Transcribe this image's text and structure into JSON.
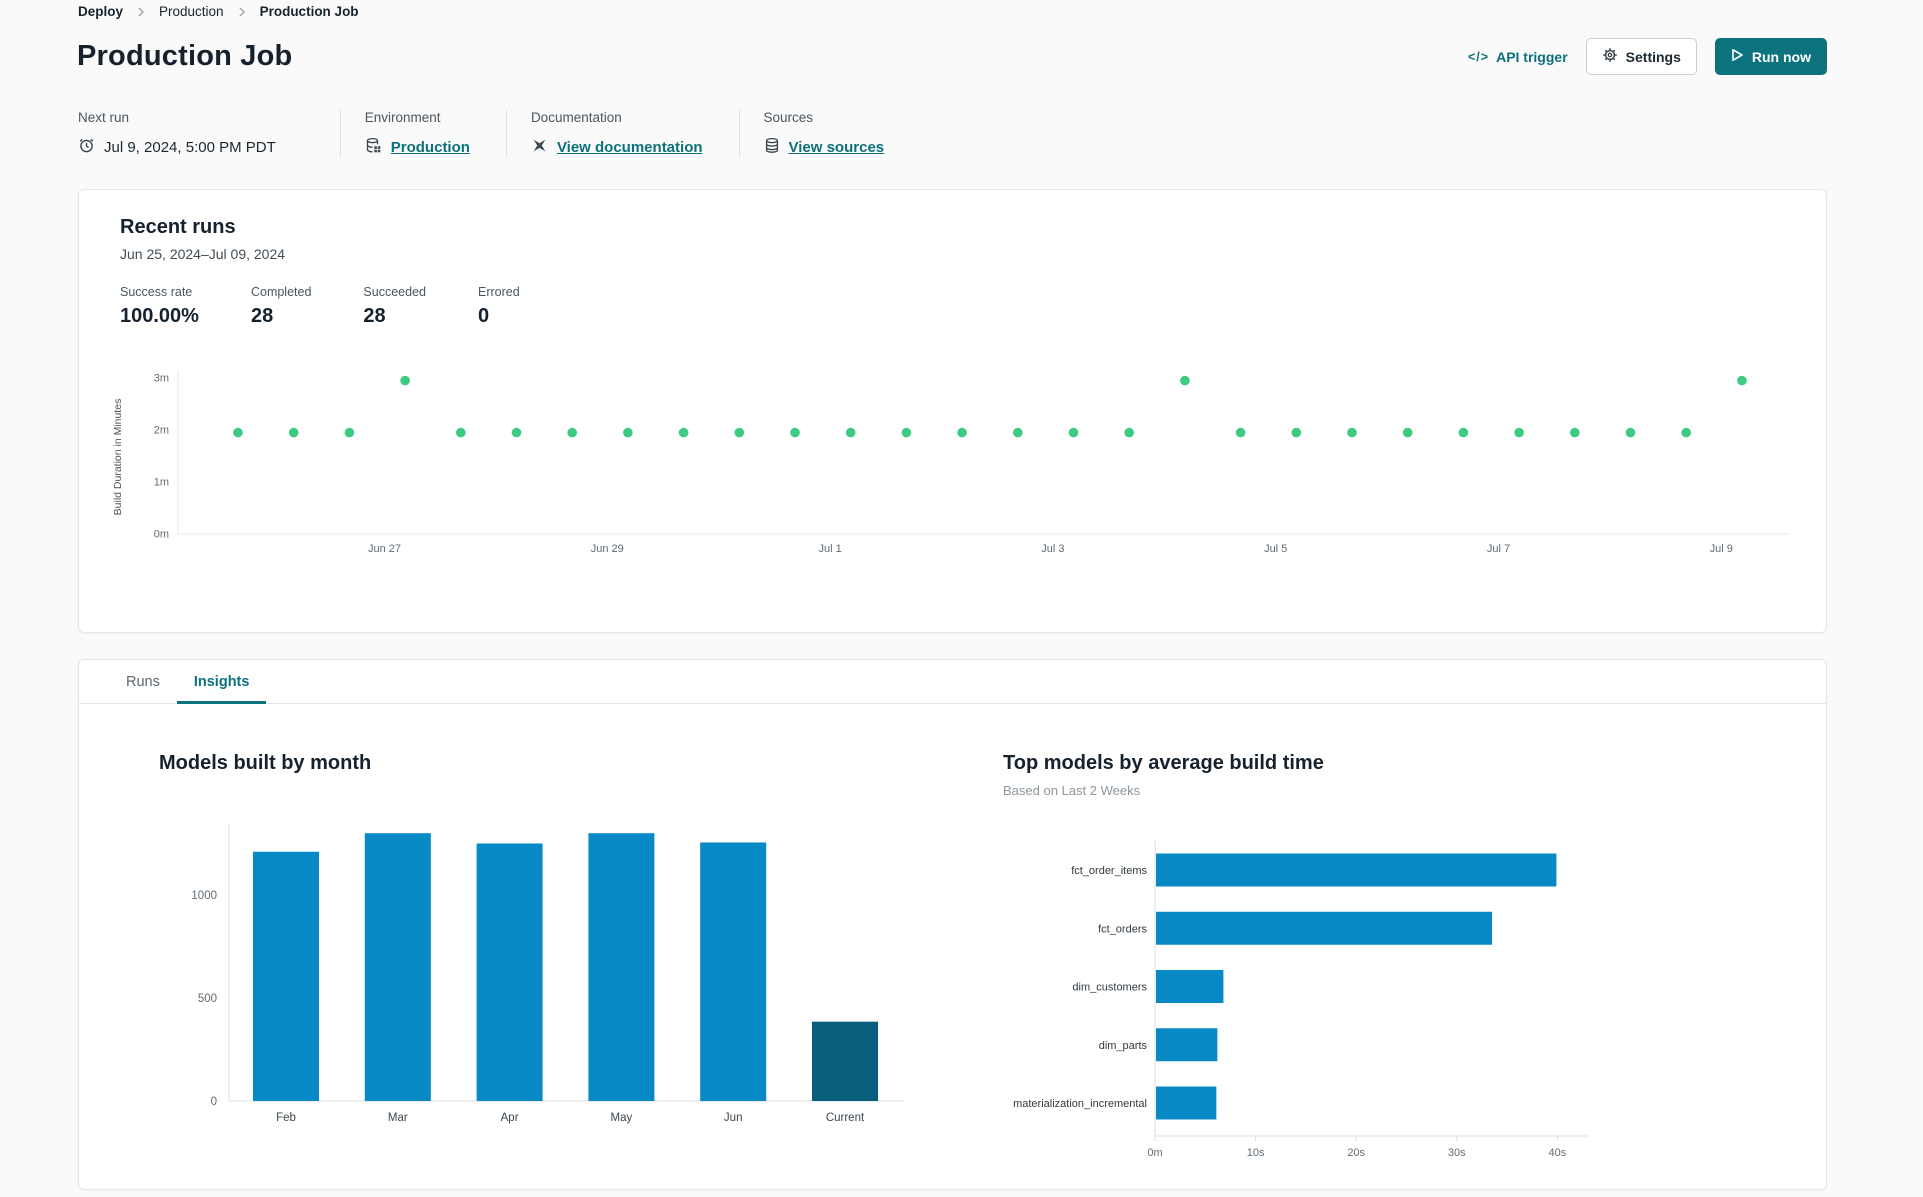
{
  "breadcrumb": {
    "items": [
      "Deploy",
      "Production",
      "Production Job"
    ]
  },
  "page": {
    "title": "Production Job"
  },
  "actions": {
    "api_trigger": "API trigger",
    "api_glyph": "</>",
    "settings": "Settings",
    "run_now": "Run now"
  },
  "info": {
    "next_run": {
      "label": "Next run",
      "value": "Jul 9, 2024, 5:00 PM PDT",
      "icon": "alarm-clock"
    },
    "environment": {
      "label": "Environment",
      "value": "Production",
      "icon": "database-grid"
    },
    "documentation": {
      "label": "Documentation",
      "value": "View documentation",
      "icon": "dbt-logo"
    },
    "sources": {
      "label": "Sources",
      "value": "View sources",
      "icon": "database-stack"
    }
  },
  "recent_runs": {
    "title": "Recent runs",
    "date_range": "Jun 25, 2024–Jul 09, 2024",
    "stats": [
      {
        "label": "Success rate",
        "value": "100.00%"
      },
      {
        "label": "Completed",
        "value": "28"
      },
      {
        "label": "Succeeded",
        "value": "28"
      },
      {
        "label": "Errored",
        "value": "0"
      }
    ]
  },
  "tabs": [
    {
      "label": "Runs"
    },
    {
      "label": "Insights"
    }
  ],
  "colors": {
    "teal": "#0c737e",
    "green_dot": "#3ccb80",
    "bar_blue": "#0789c5",
    "bar_dark_blue": "#085e7d",
    "axis_line": "#dcdfe2",
    "tick_text": "#5f6b73"
  },
  "chart_data": [
    {
      "type": "scatter",
      "name": "recent-run-durations",
      "ylabel": "Build Duration in Minutes",
      "yticks": [
        {
          "label": "0m",
          "v": 0
        },
        {
          "label": "1m",
          "v": 1
        },
        {
          "label": "2m",
          "v": 2
        },
        {
          "label": "3m",
          "v": 3
        }
      ],
      "ylim": [
        0,
        3.3
      ],
      "xticks": [
        {
          "label": "Jun 27",
          "i": 2.63
        },
        {
          "label": "Jun 29",
          "i": 6.63
        },
        {
          "label": "Jul 1",
          "i": 10.63
        },
        {
          "label": "Jul 3",
          "i": 14.63
        },
        {
          "label": "Jul 5",
          "i": 18.63
        },
        {
          "label": "Jul 7",
          "i": 22.63
        },
        {
          "label": "Jul 9",
          "i": 26.63
        }
      ],
      "values": [
        1.95,
        1.95,
        1.95,
        2.95,
        1.95,
        1.95,
        1.95,
        1.95,
        1.95,
        1.95,
        1.95,
        1.95,
        1.95,
        1.95,
        1.95,
        1.95,
        1.95,
        2.95,
        1.95,
        1.95,
        1.95,
        1.95,
        1.95,
        1.95,
        1.95,
        1.95,
        1.95,
        2.95
      ]
    },
    {
      "type": "bar",
      "title": "Models built by month",
      "categories": [
        "Feb",
        "Mar",
        "Apr",
        "May",
        "Jun",
        "Current"
      ],
      "values": [
        1210,
        1300,
        1250,
        1300,
        1255,
        385
      ],
      "yticks": [
        0,
        500,
        1000
      ],
      "ylim": [
        0,
        1400
      ],
      "highlight_index": 5
    },
    {
      "type": "horizontal-bar",
      "title": "Top models by average build time",
      "subtitle": "Based on Last 2 Weeks",
      "categories": [
        "fct_order_items",
        "fct_orders",
        "dim_customers",
        "dim_parts",
        "materialization_incremental"
      ],
      "values_seconds": [
        39.8,
        33.4,
        6.7,
        6.1,
        6.0
      ],
      "xticks": [
        {
          "label": "0m",
          "v": 0
        },
        {
          "label": "10s",
          "v": 10
        },
        {
          "label": "20s",
          "v": 20
        },
        {
          "label": "30s",
          "v": 30
        },
        {
          "label": "40s",
          "v": 40
        }
      ],
      "xlim": [
        0,
        43
      ]
    }
  ]
}
